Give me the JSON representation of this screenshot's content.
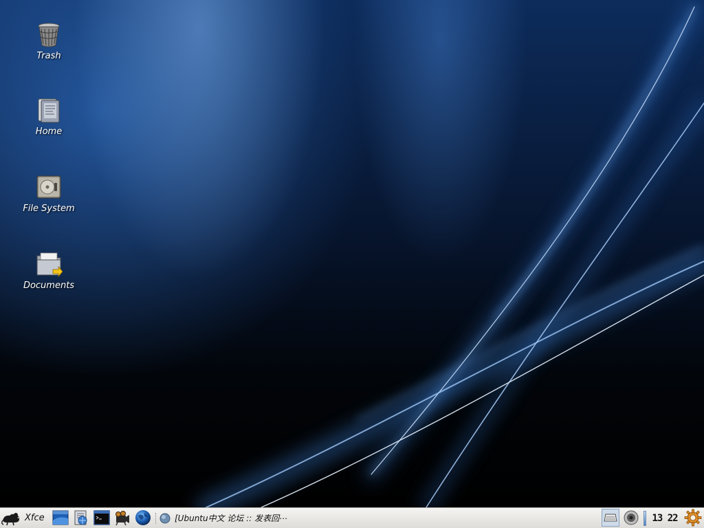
{
  "desktop": {
    "icons": [
      {
        "label": "Trash"
      },
      {
        "label": "Home"
      },
      {
        "label": "File System"
      },
      {
        "label": "Documents"
      }
    ]
  },
  "panel": {
    "menu_label": "Xfce",
    "launchers": [
      "desktop-launcher-icon",
      "file-manager-launcher-icon",
      "terminal-launcher-icon",
      "media-player-launcher-icon",
      "web-browser-launcher-icon"
    ],
    "task": {
      "title": "[Ubuntu中文 论坛 :: 发表回⋯"
    },
    "clock": "13 22"
  }
}
